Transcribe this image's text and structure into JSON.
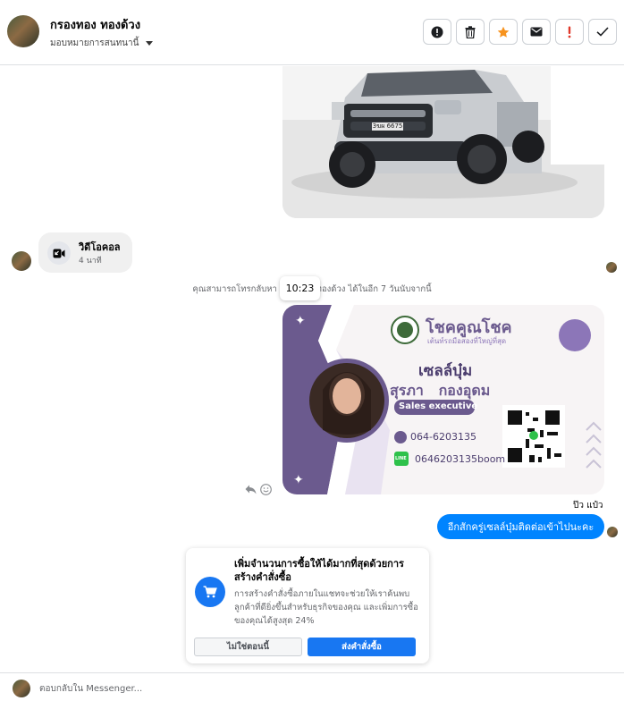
{
  "header": {
    "contact_name": "กรองทอง ทองด้วง",
    "assign_label": "มอบหมายการสนทนานี้",
    "toolbar_icons": [
      "info-icon",
      "trash-icon",
      "star-icon",
      "mail-icon",
      "alert-icon",
      "check-icon"
    ]
  },
  "thread": {
    "video_call": {
      "title": "วิดีโอคอล",
      "duration": "4 นาที"
    },
    "system_message": "คุณสามารถโทรกลับหา กรองทอง ทองด้วง ได้ในอีก 7 วันนับจากนี้",
    "timestamp_tooltip": "10:23",
    "car_plate": "3ฆผ 6675",
    "card": {
      "brand": "โชคคูณโชค",
      "tagline": "เต้นท์รถมือสองที่ใหญ่ที่สุด",
      "nickname": "เซลล์บุ๋ม",
      "fullname": "สุรภา   กองอุดม",
      "role": "Sales executive",
      "phone": "064-6203135",
      "line_label": "LINE",
      "line_id": "0646203135boom"
    },
    "seen_by": "ป๊ว แป๋ว",
    "outgoing_message": "อีกสักครู่เซลล์บุ๋มติดต่อเข้าไปนะคะ"
  },
  "promo": {
    "title": "เพิ่มจำนวนการซื้อให้ได้มากที่สุดด้วยการสร้างคำสั่งซื้อ",
    "body": "การสร้างคำสั่งซื้อภายในแชทจะช่วยให้เราค้นพบลูกค้าที่ดียิ่งขึ้นสำหรับธุรกิจของคุณ และเพิ่มการซื้อของคุณได้สูงสุด 24%",
    "decline_label": "ไม่ใช่ตอนนี้",
    "accept_label": "ส่งคำสั่งซื้อ"
  },
  "composer": {
    "placeholder": "ตอบกลับใน Messenger..."
  },
  "colors": {
    "accent": "#0084ff",
    "primary_button": "#1877f2",
    "star": "#f7931e",
    "alert": "#e0392b",
    "card_purple": "#6b5a8e"
  }
}
